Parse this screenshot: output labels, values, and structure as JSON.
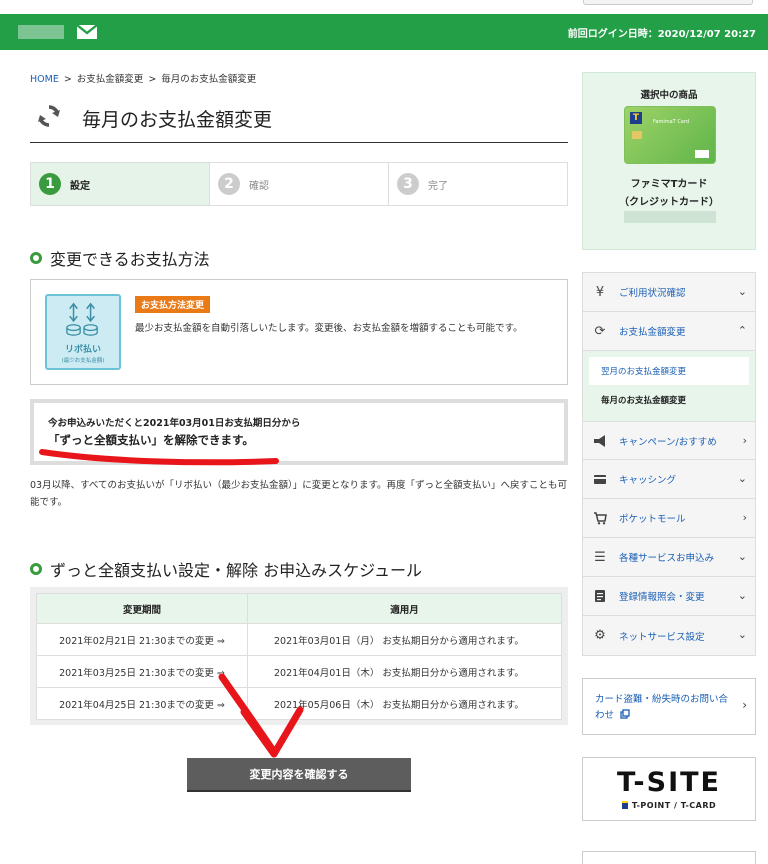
{
  "header": {
    "last_login": "前回ログイン日時：2020/12/07 20:27"
  },
  "breadcrumb": {
    "items": [
      "HOME",
      "お支払金額変更",
      "毎月のお支払金額変更"
    ],
    "separator": ">"
  },
  "page_title": "毎月のお支払金額変更",
  "steps": [
    {
      "num": "1",
      "label": "設定",
      "active": true
    },
    {
      "num": "2",
      "label": "確認",
      "active": false
    },
    {
      "num": "3",
      "label": "完了",
      "active": false
    }
  ],
  "method_section": {
    "heading": "変更できるお支払方法",
    "revo_label": "リボ払い",
    "revo_sub": "(最少お支払金額)",
    "tag": "お支払方法変更",
    "description": "最少お支払金額を自動引落しいたします。変更後、お支払金額を増額することも可能です。"
  },
  "notice": {
    "line1": "今お申込みいただくと2021年03月01日お支払期日分から",
    "line2": "「ずっと全額支払い」を解除できます。",
    "paragraph": "03月以降、すべてのお支払いが「リボ払い（最少お支払金額）」に変更となります。再度「ずっと全額支払い」へ戻すことも可能です。"
  },
  "schedule": {
    "heading": "ずっと全額支払い設定・解除 お申込みスケジュール",
    "columns": [
      "変更期間",
      "適用月"
    ],
    "rows": [
      [
        "2021年02月21日 21:30までの変更 ⇒",
        "2021年03月01日（月） お支払期日分から適用されます。"
      ],
      [
        "2021年03月25日 21:30までの変更 ⇒",
        "2021年04月01日（木） お支払期日分から適用されます。"
      ],
      [
        "2021年04月25日 21:30までの変更 ⇒",
        "2021年05月06日（木） お支払期日分から適用されます。"
      ]
    ]
  },
  "confirm_button": "変更内容を確認する",
  "sidebar": {
    "product_heading": "選択中の商品",
    "card_name": "FamimaT Card",
    "card_brand": "FamilyMart",
    "product_name_line1": "ファミマTカード",
    "product_name_line2": "（クレジットカード）",
    "menu": [
      {
        "icon": "yen-icon",
        "label": "ご利用状況確認",
        "chevron": "down"
      },
      {
        "icon": "refresh-icon",
        "label": "お支払金額変更",
        "chevron": "up"
      },
      {
        "icon": "megaphone-icon",
        "label": "キャンペーン/おすすめ",
        "chevron": "right"
      },
      {
        "icon": "card-icon",
        "label": "キャッシング",
        "chevron": "down"
      },
      {
        "icon": "cart-icon",
        "label": "ポケットモール",
        "chevron": "right"
      },
      {
        "icon": "list-icon",
        "label": "各種サービスお申込み",
        "chevron": "down"
      },
      {
        "icon": "document-icon",
        "label": "登録情報照会・変更",
        "chevron": "down"
      },
      {
        "icon": "gear-icon",
        "label": "ネットサービス設定",
        "chevron": "down"
      }
    ],
    "submenu": [
      "翌月のお支払金額変更",
      "毎月のお支払金額変更"
    ],
    "lost_card": "カード盗難・紛失時のお問い合わせ",
    "tsite_logo": "T-SITE",
    "tsite_sub": "T-POINT / T-CARD"
  },
  "colors": {
    "brand_green": "#23a047",
    "accent_orange": "#ea7a16",
    "link_blue": "#1a5fb4",
    "annotation_red": "#e8151b"
  }
}
